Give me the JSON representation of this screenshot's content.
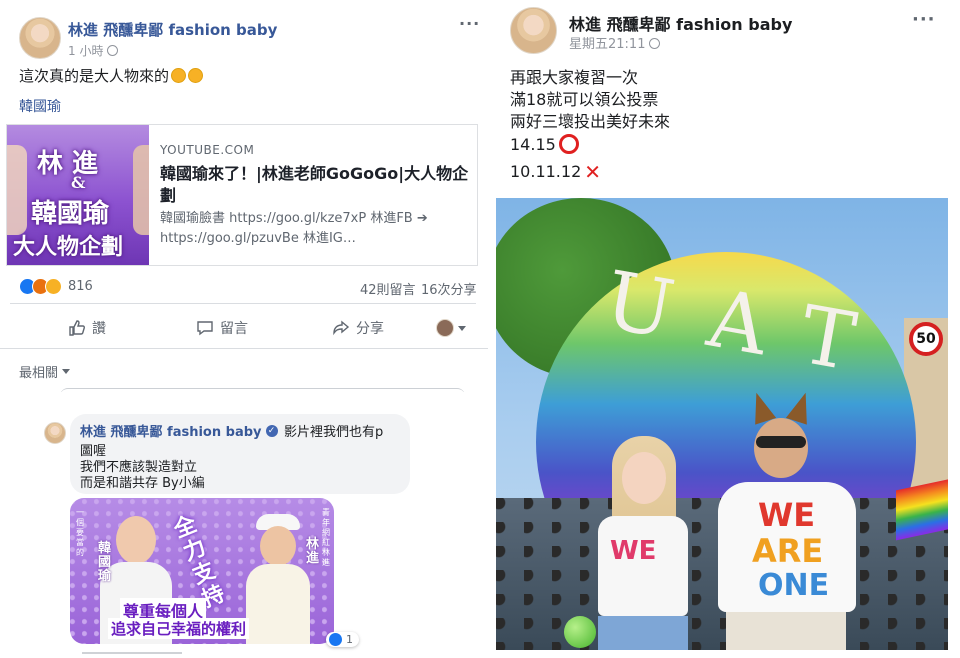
{
  "post_left": {
    "author": "林進 飛醺卑鄙 fashion baby",
    "time": "1 小時",
    "text": "這次真的是大人物來的",
    "tag": "韓國瑜",
    "link": {
      "domain": "YOUTUBE.COM",
      "title": "韓國瑜來了！|林進老師GoGoGo|大人物企劃",
      "desc": "韓國瑜臉書 https://goo.gl/kze7xP 林進FB ➔ https://goo.gl/pzuvBe 林進IG…",
      "thumb_lines": [
        "林 進",
        "&",
        "韓國瑜",
        "大人物企劃"
      ]
    },
    "reactions_count": "816",
    "comments": "42則留言",
    "shares": "16次分享",
    "actions": {
      "like": "讚",
      "comment": "留言",
      "share": "分享"
    },
    "sort": "最相關"
  },
  "comment": {
    "author": "林進 飛醺卑鄙 fashion baby",
    "text_lines": [
      "影片裡我們也有p",
      "圖喔",
      "我們不應該製造對立",
      "而是和諧共存 By小編"
    ],
    "image": {
      "left_label": "韓國瑜",
      "right_label": "林 進",
      "tagline": "全力支持",
      "caption1": "尊重每個人",
      "caption2": "追求自己幸福的權利",
      "left_side": "一個要當的",
      "right_side": "青年網紅林進"
    },
    "likes": "1"
  },
  "post_right": {
    "author": "林進 飛醺卑鄙 fashion baby",
    "time": "星期五21:11",
    "lines": [
      "再跟大家複習一次",
      "滿18就可以領公投票",
      "兩好三壞投出美好未來",
      "14.15",
      "10.11.12"
    ],
    "photo": {
      "balloon_text": "UAT",
      "sign": "50",
      "shirt1": "WE ARE ONE",
      "shirt_top": "WE",
      "shirt_mid": "ARE",
      "shirt_bot": "ONE",
      "shirt_left": "WE"
    }
  }
}
